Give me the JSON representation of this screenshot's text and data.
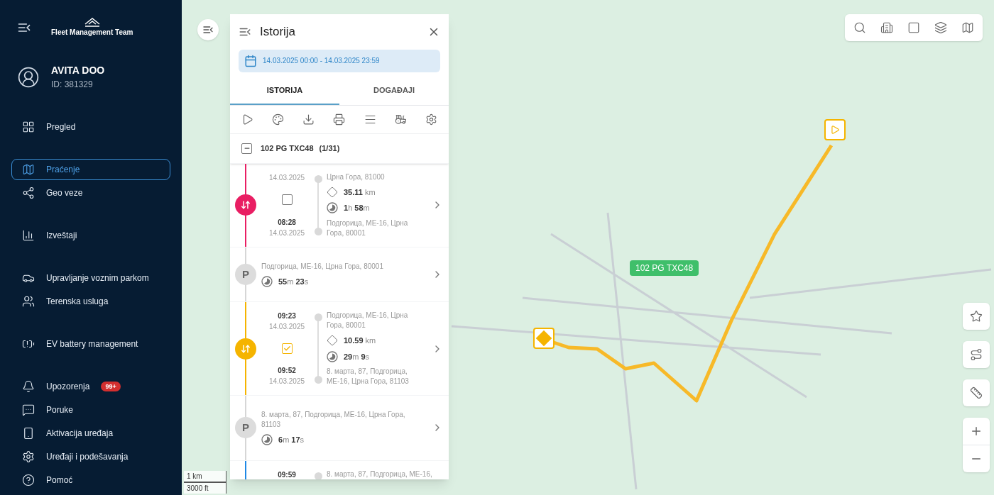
{
  "sidebar": {
    "brand": "Fleet Management Team",
    "account": {
      "name": "AVITA DOO",
      "id": "ID: 381329"
    },
    "groups": [
      [
        {
          "label": "Pregled",
          "selected": false
        }
      ],
      [
        {
          "label": "Praćenje",
          "selected": true
        },
        {
          "label": "Geo veze",
          "selected": false
        }
      ],
      [
        {
          "label": "Izveštaji",
          "selected": false
        }
      ],
      [
        {
          "label": "Upravljanje voznim parkom",
          "selected": false
        },
        {
          "label": "Terenska usluga",
          "selected": false
        }
      ],
      [
        {
          "label": "EV battery management",
          "selected": false
        }
      ],
      [
        {
          "label": "Upozorenja",
          "selected": false,
          "badge": "99+"
        },
        {
          "label": "Poruke",
          "selected": false
        },
        {
          "label": "Aktivacija uređaja",
          "selected": false
        },
        {
          "label": "Uređaji i podešavanja",
          "selected": false
        },
        {
          "label": "Pomoć",
          "selected": false
        }
      ]
    ]
  },
  "panel": {
    "title": "Istorija",
    "date_range": "14.03.2025 00:00 - 14.03.2025 23:59",
    "tabs": [
      {
        "label": "ISTORIJA",
        "selected": true
      },
      {
        "label": "DOGAĐAJI",
        "selected": false
      }
    ],
    "vehicle": {
      "name": "102 PG TXC48",
      "count": "(1/31)",
      "expanded": true
    },
    "entries": [
      {
        "kind": "trip",
        "color": "#e91e63",
        "checked": false,
        "start_date": "14.03.2025",
        "start_address": "Црна Гора, 81000",
        "distance": {
          "value": "35.11",
          "unit": "km"
        },
        "duration": [
          {
            "value": "1",
            "unit": "h"
          },
          {
            "value": "58",
            "unit": "m"
          }
        ],
        "end_time": "08:28",
        "end_date": "14.03.2025",
        "end_address": "Подгорица, МЕ-16, Црна Гора, 80001"
      },
      {
        "kind": "parking",
        "badge": "P",
        "address": "Подгорица, МЕ-16, Црна Гора, 80001",
        "duration": [
          {
            "value": "55",
            "unit": "m"
          },
          {
            "value": "23",
            "unit": "s"
          }
        ]
      },
      {
        "kind": "trip",
        "color": "#f5b400",
        "checked": true,
        "start_time": "09:23",
        "start_date": "14.03.2025",
        "start_address": "Подгорица, МЕ-16, Црна Гора, 80001",
        "distance": {
          "value": "10.59",
          "unit": "km"
        },
        "duration": [
          {
            "value": "29",
            "unit": "m"
          },
          {
            "value": "9",
            "unit": "s"
          }
        ],
        "end_time": "09:52",
        "end_date": "14.03.2025",
        "end_address": "8. марта, 87, Подгорица, МЕ-16, Црна Гора, 81103"
      },
      {
        "kind": "parking",
        "badge": "P",
        "address": "8. марта, 87, Подгорица, МЕ-16, Црна Гора, 81103",
        "duration": [
          {
            "value": "6",
            "unit": "m"
          },
          {
            "value": "17",
            "unit": "s"
          }
        ]
      },
      {
        "kind": "trip",
        "color": "#1e88e5",
        "start_time": "09:59",
        "start_address": "8. марта, 87, Подгорица, МЕ-16,"
      }
    ]
  },
  "map": {
    "vehicle_label": "102 PG TXC48",
    "scale": [
      "1 km",
      "3000 ft"
    ]
  }
}
